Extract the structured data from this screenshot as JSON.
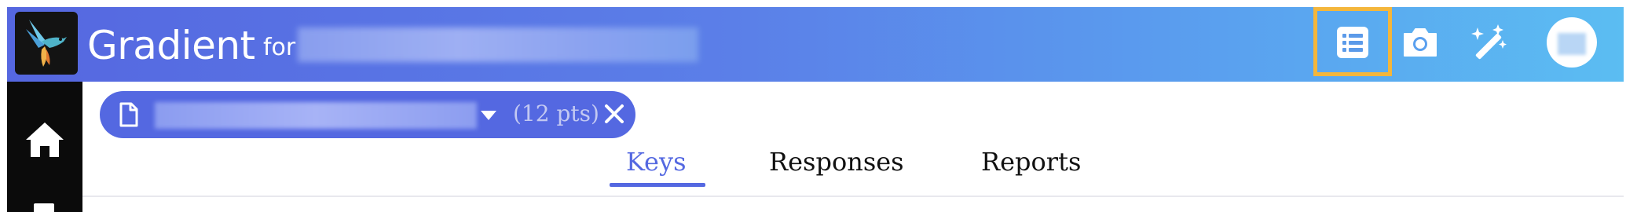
{
  "app": {
    "name": "Gradient",
    "for_label": "for",
    "accent_color": "#5468e1"
  },
  "toolbar": {
    "icons": [
      "list-icon",
      "camera-icon",
      "magic-wand-icon"
    ],
    "highlight_color": "#f4b63b"
  },
  "document_chip": {
    "points_label": "(12 pts)"
  },
  "tabs": [
    {
      "label": "Keys",
      "active": true
    },
    {
      "label": "Responses",
      "active": false
    },
    {
      "label": "Reports",
      "active": false
    }
  ]
}
